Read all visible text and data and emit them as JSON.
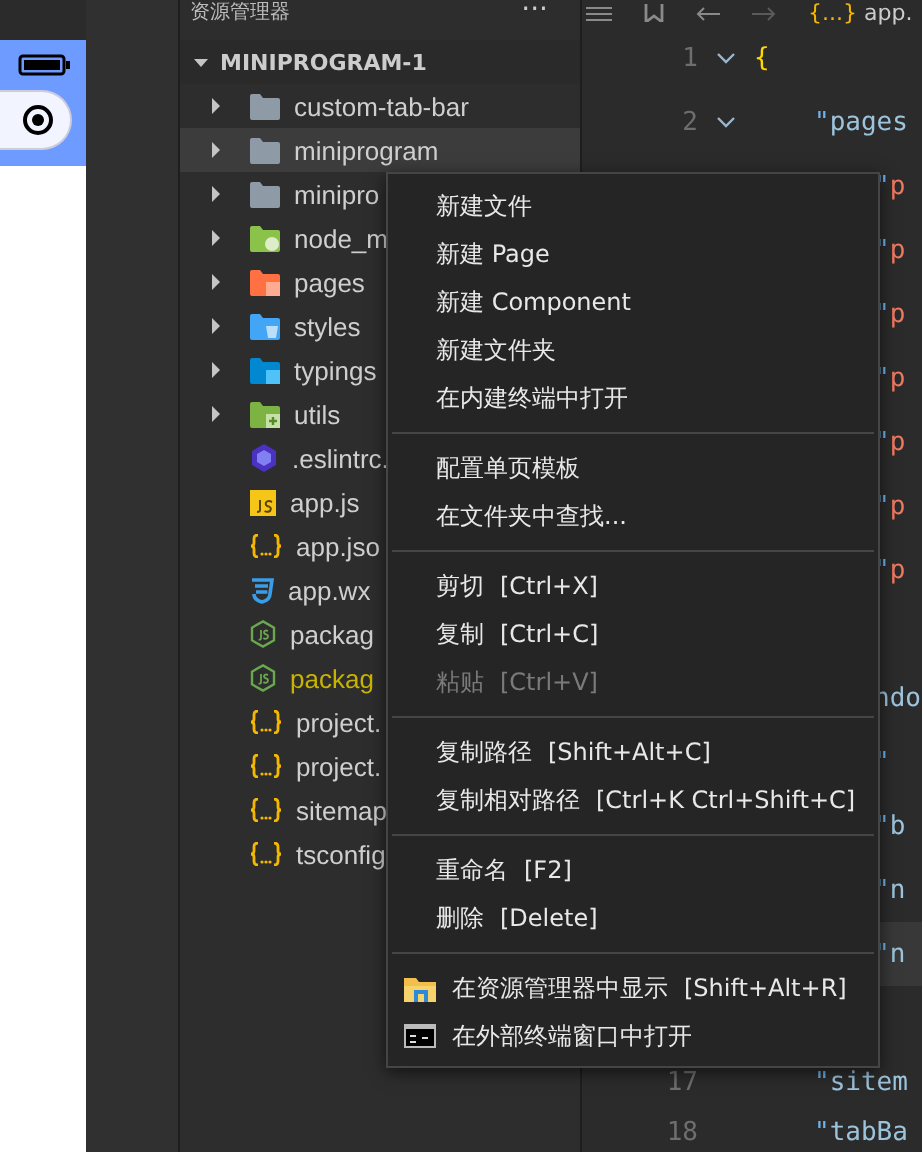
{
  "explorer": {
    "title": "资源管理器",
    "more": "···",
    "section": {
      "title": "MINIPROGRAM-1",
      "expanded": true
    },
    "items": [
      {
        "name": "custom-tab-bar",
        "kind": "folder",
        "expanded": false,
        "selected": false,
        "modified": false
      },
      {
        "name": "miniprogram",
        "kind": "folder",
        "expanded": false,
        "selected": true,
        "modified": false
      },
      {
        "name": "minipro",
        "kind": "folder",
        "expanded": false,
        "selected": false,
        "modified": false
      },
      {
        "name": "node_m",
        "kind": "node-folder",
        "expanded": false,
        "selected": false,
        "modified": false
      },
      {
        "name": "pages",
        "kind": "pages-folder",
        "expanded": false,
        "selected": false,
        "modified": false
      },
      {
        "name": "styles",
        "kind": "styles-folder",
        "expanded": false,
        "selected": false,
        "modified": false
      },
      {
        "name": "typings",
        "kind": "ts-folder",
        "expanded": false,
        "selected": false,
        "modified": false
      },
      {
        "name": "utils",
        "kind": "utils-folder",
        "expanded": false,
        "selected": false,
        "modified": false
      },
      {
        "name": ".eslintrc.",
        "kind": "eslint",
        "selected": false,
        "modified": false
      },
      {
        "name": "app.js",
        "kind": "js",
        "selected": false,
        "modified": false
      },
      {
        "name": "app.jso",
        "kind": "json",
        "selected": false,
        "modified": false
      },
      {
        "name": "app.wx",
        "kind": "css",
        "selected": false,
        "modified": false
      },
      {
        "name": "packag",
        "kind": "node",
        "selected": false,
        "modified": false
      },
      {
        "name": "packag",
        "kind": "node",
        "selected": false,
        "modified": true
      },
      {
        "name": "project.",
        "kind": "json",
        "selected": false,
        "modified": false
      },
      {
        "name": "project.",
        "kind": "json",
        "selected": false,
        "modified": false
      },
      {
        "name": "sitemap",
        "kind": "json",
        "selected": false,
        "modified": false
      },
      {
        "name": "tsconfig",
        "kind": "json",
        "selected": false,
        "modified": false
      }
    ]
  },
  "editor": {
    "tab": {
      "icon_text": "{...}",
      "label": "app."
    },
    "lines": [
      {
        "kind": "top",
        "number": "1",
        "fold": true,
        "current": false,
        "tokens": [
          {
            "kind": "brace",
            "text": "{"
          }
        ]
      },
      {
        "kind": "key",
        "number": "2",
        "fold": true,
        "current": false,
        "tokens": [
          {
            "kind": "quote",
            "text": "\""
          },
          {
            "kind": "key",
            "text": "pages"
          }
        ]
      },
      {
        "kind": "entry",
        "current": false,
        "tokens": [
          {
            "kind": "quote",
            "text": "\""
          },
          {
            "kind": "string",
            "text": "p"
          }
        ]
      },
      {
        "kind": "entry",
        "current": false,
        "tokens": [
          {
            "kind": "quote",
            "text": "\""
          },
          {
            "kind": "string",
            "text": "p"
          }
        ]
      },
      {
        "kind": "entry",
        "current": false,
        "tokens": [
          {
            "kind": "quote",
            "text": "\""
          },
          {
            "kind": "string",
            "text": "p"
          }
        ]
      },
      {
        "kind": "entry",
        "current": false,
        "tokens": [
          {
            "kind": "quote",
            "text": "\""
          },
          {
            "kind": "string",
            "text": "p"
          }
        ]
      },
      {
        "kind": "entry",
        "current": false,
        "tokens": [
          {
            "kind": "quote",
            "text": "\""
          },
          {
            "kind": "string",
            "text": "p"
          }
        ]
      },
      {
        "kind": "entry",
        "current": false,
        "tokens": [
          {
            "kind": "quote",
            "text": "\""
          },
          {
            "kind": "string",
            "text": "p"
          }
        ]
      },
      {
        "kind": "entry",
        "current": false,
        "tokens": [
          {
            "kind": "quote",
            "text": "\""
          },
          {
            "kind": "string",
            "text": "p"
          }
        ]
      },
      {
        "kind": "covered",
        "current": false
      },
      {
        "kind": "entry",
        "current": false,
        "tokens": [
          {
            "kind": "key",
            "text": "ndo"
          }
        ]
      },
      {
        "kind": "entry",
        "current": false,
        "tokens": [
          {
            "kind": "quote",
            "text": "\""
          }
        ]
      },
      {
        "kind": "entry",
        "current": false,
        "tokens": [
          {
            "kind": "quote",
            "text": "\""
          },
          {
            "kind": "key",
            "text": "b"
          }
        ]
      },
      {
        "kind": "entry",
        "current": false,
        "tokens": [
          {
            "kind": "quote",
            "text": "\""
          },
          {
            "kind": "key",
            "text": "n"
          }
        ]
      },
      {
        "kind": "entry",
        "current": true,
        "tokens": [
          {
            "kind": "quote",
            "text": "\""
          },
          {
            "kind": "key",
            "text": "n"
          }
        ]
      },
      {
        "kind": "covered",
        "current": false
      },
      {
        "kind": "key",
        "number": "17",
        "current": false,
        "tokens": [
          {
            "kind": "quote",
            "text": "\""
          },
          {
            "kind": "key",
            "text": "sitem"
          }
        ]
      },
      {
        "kind": "key",
        "number": "18",
        "current": false,
        "tokens": [
          {
            "kind": "quote",
            "text": "\""
          },
          {
            "kind": "key",
            "text": "tabBa"
          }
        ]
      }
    ]
  },
  "context_menu": {
    "groups": [
      [
        {
          "label": "新建文件",
          "kind": "plain",
          "disabled": false
        },
        {
          "label": "新建 Page",
          "kind": "plain",
          "disabled": false
        },
        {
          "label": "新建 Component",
          "kind": "plain",
          "disabled": false
        },
        {
          "label": "新建文件夹",
          "kind": "plain",
          "disabled": false
        },
        {
          "label": "在内建终端中打开",
          "kind": "plain",
          "disabled": false
        }
      ],
      [
        {
          "label": "配置单页模板",
          "kind": "plain",
          "disabled": false
        },
        {
          "label": "在文件夹中查找...",
          "kind": "plain",
          "disabled": false
        }
      ],
      [
        {
          "label": "剪切",
          "shortcut": "[Ctrl+X]",
          "kind": "plain",
          "disabled": false
        },
        {
          "label": "复制",
          "shortcut": "[Ctrl+C]",
          "kind": "plain",
          "disabled": false
        },
        {
          "label": "粘贴",
          "shortcut": "[Ctrl+V]",
          "kind": "plain",
          "disabled": true
        }
      ],
      [
        {
          "label": "复制路径",
          "shortcut": "[Shift+Alt+C]",
          "kind": "plain",
          "disabled": false
        },
        {
          "label": "复制相对路径",
          "shortcut": "[Ctrl+K Ctrl+Shift+C]",
          "kind": "plain",
          "disabled": false
        }
      ],
      [
        {
          "label": "重命名",
          "shortcut": "[F2]",
          "kind": "plain",
          "disabled": false
        },
        {
          "label": "删除",
          "shortcut": "[Delete]",
          "kind": "plain",
          "disabled": false
        }
      ],
      [
        {
          "label": "在资源管理器中显示",
          "shortcut": "[Shift+Alt+R]",
          "kind": "explorer",
          "disabled": false
        },
        {
          "label": "在外部终端窗口中打开",
          "kind": "terminal",
          "disabled": false
        }
      ]
    ]
  }
}
